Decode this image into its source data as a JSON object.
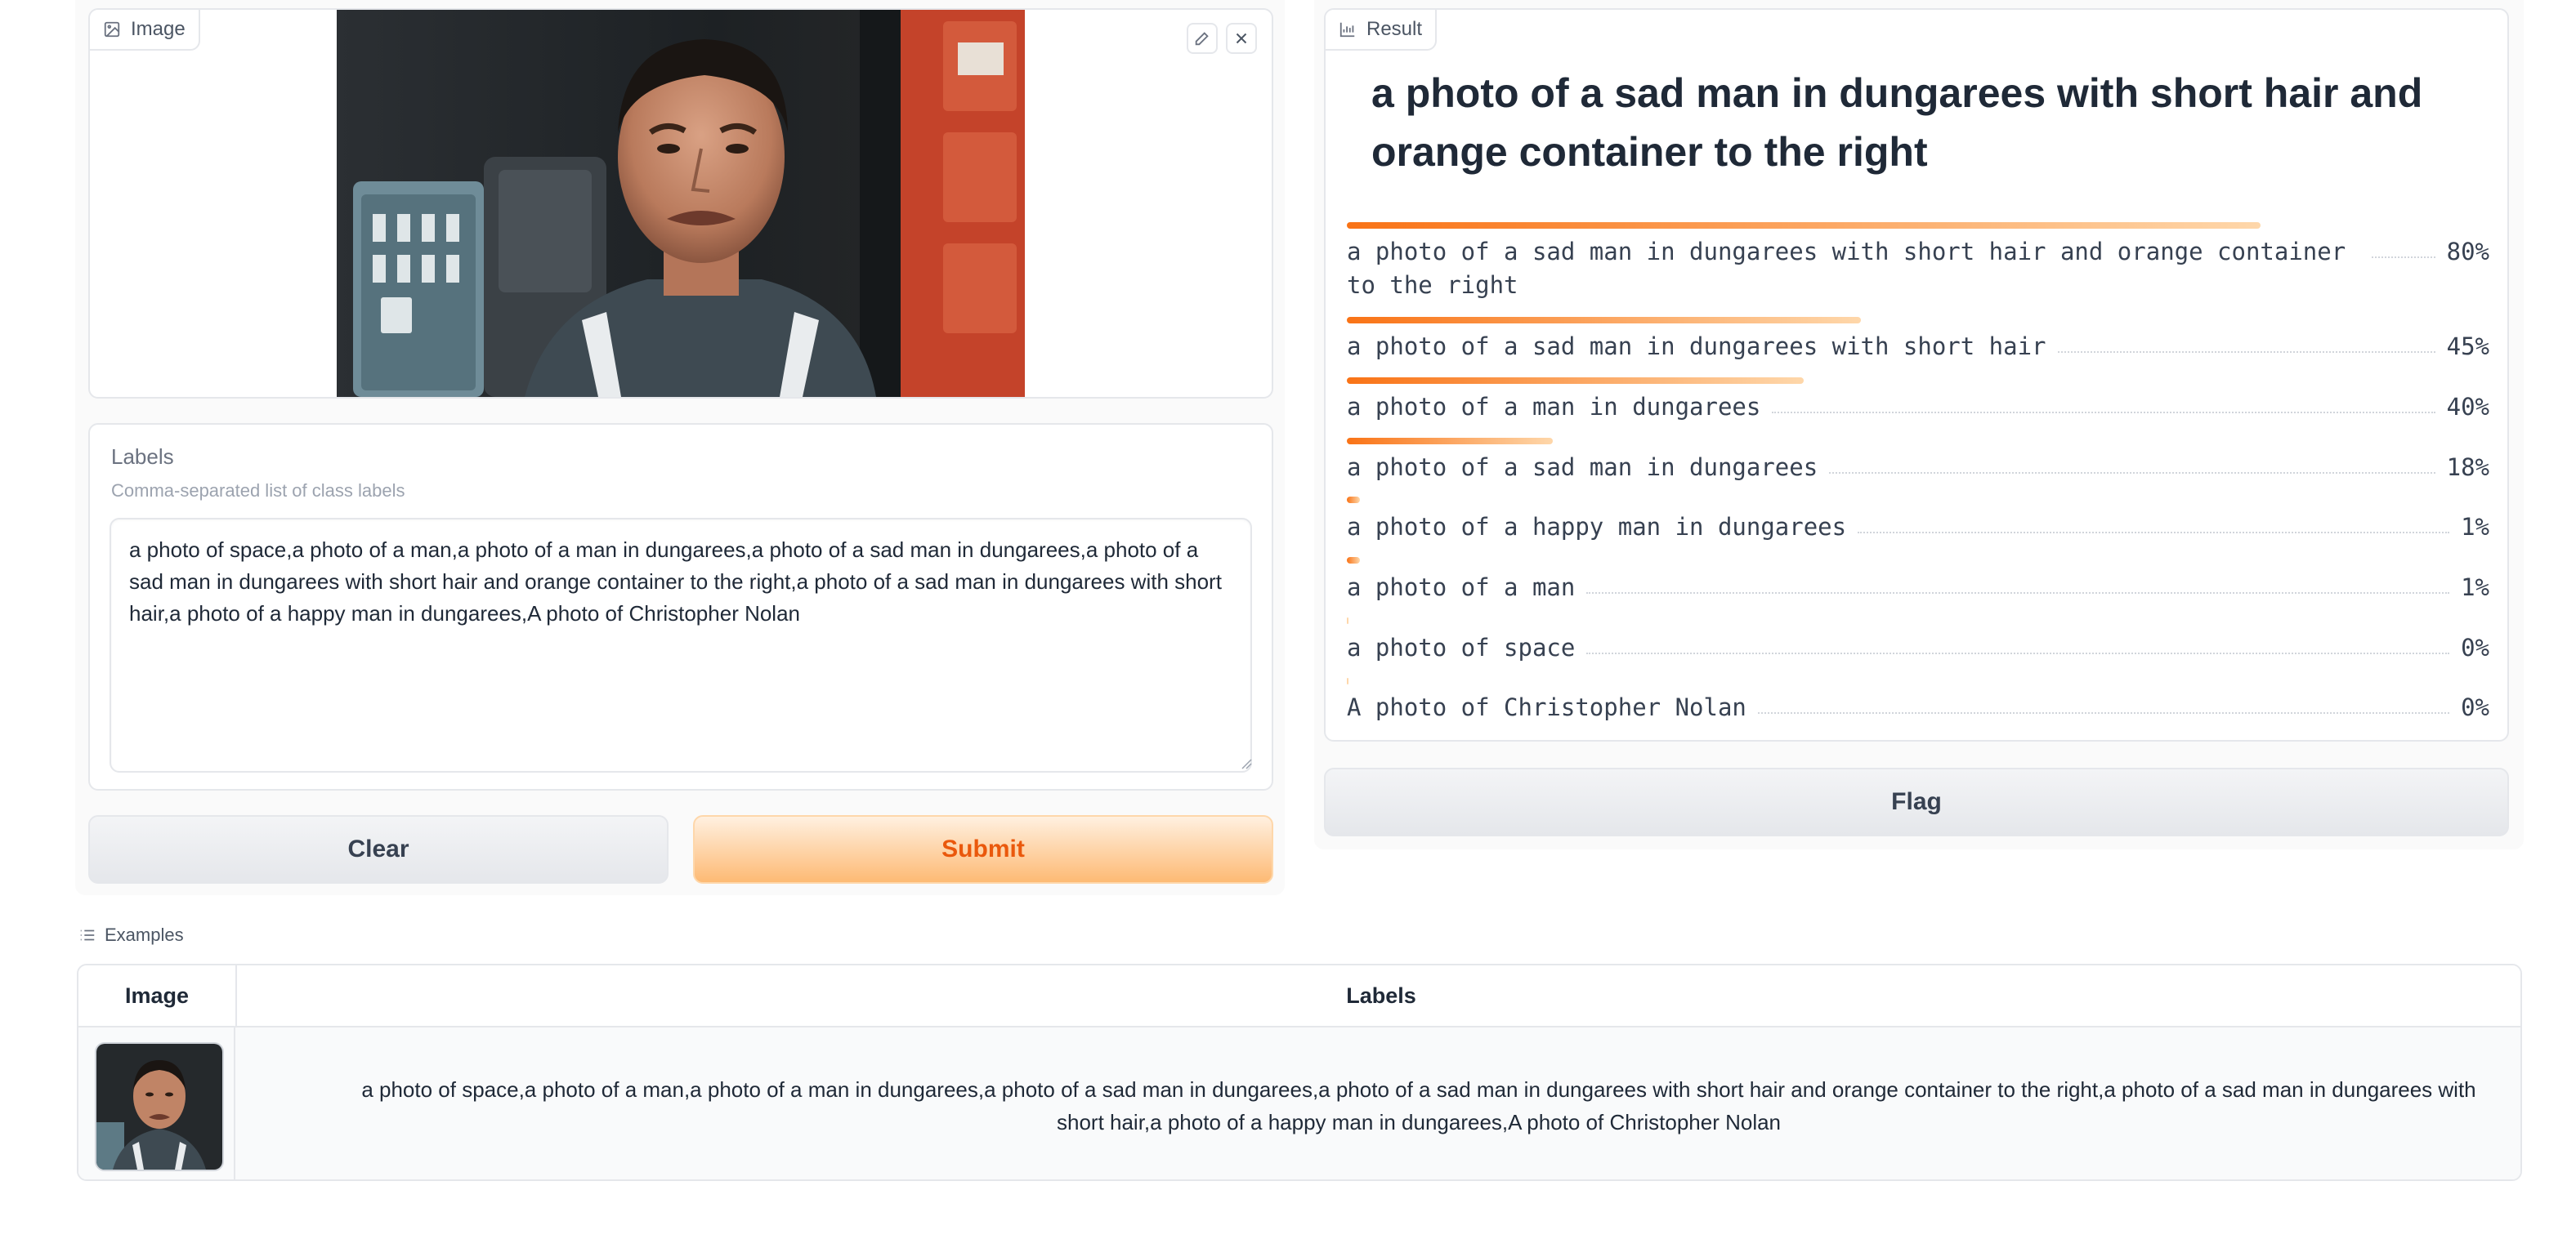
{
  "image_panel": {
    "label": "Image"
  },
  "labels": {
    "title": "Labels",
    "info": "Comma-separated list of class labels",
    "value": "a photo of space,a photo of a man,a photo of a man in dungarees,a photo of a sad man in dungarees,a photo of a sad man in dungarees with short hair and orange container to the right,a photo of a sad man in dungarees with short hair,a photo of a happy man in dungarees,A photo of Christopher Nolan"
  },
  "buttons": {
    "clear": "Clear",
    "submit": "Submit",
    "flag": "Flag"
  },
  "result": {
    "label": "Result",
    "top_label": "a photo of a sad man in dungarees with short hair and orange container to the right",
    "confidences": [
      {
        "label": "a photo of a sad man in dungarees with short hair and orange container to the right",
        "pct": "80%",
        "value": 0.8
      },
      {
        "label": "a photo of a sad man in dungarees with short hair",
        "pct": "45%",
        "value": 0.45
      },
      {
        "label": "a photo of a man in dungarees",
        "pct": "40%",
        "value": 0.4
      },
      {
        "label": "a photo of a sad man in dungarees",
        "pct": "18%",
        "value": 0.18
      },
      {
        "label": "a photo of a happy man in dungarees",
        "pct": "1%",
        "value": 0.01
      },
      {
        "label": "a photo of a man",
        "pct": "1%",
        "value": 0.01
      },
      {
        "label": "a photo of space",
        "pct": "0%",
        "value": 0.0
      },
      {
        "label": "A photo of Christopher Nolan",
        "pct": "0%",
        "value": 0.0
      }
    ]
  },
  "examples": {
    "title": "Examples",
    "headers": [
      "Image",
      "Labels"
    ],
    "rows": [
      {
        "labels": "a photo of space,a photo of a man,a photo of a man in dungarees,a photo of a sad man in dungarees,a photo of a sad man in dungarees with short hair and orange container to the right,a photo of a sad man in dungarees with short hair,a photo of a happy man in dungarees,A photo of Christopher Nolan"
      }
    ]
  },
  "colors": {
    "accent": "#f97316",
    "accent_light": "#fed7aa",
    "border": "#e5e7eb"
  }
}
